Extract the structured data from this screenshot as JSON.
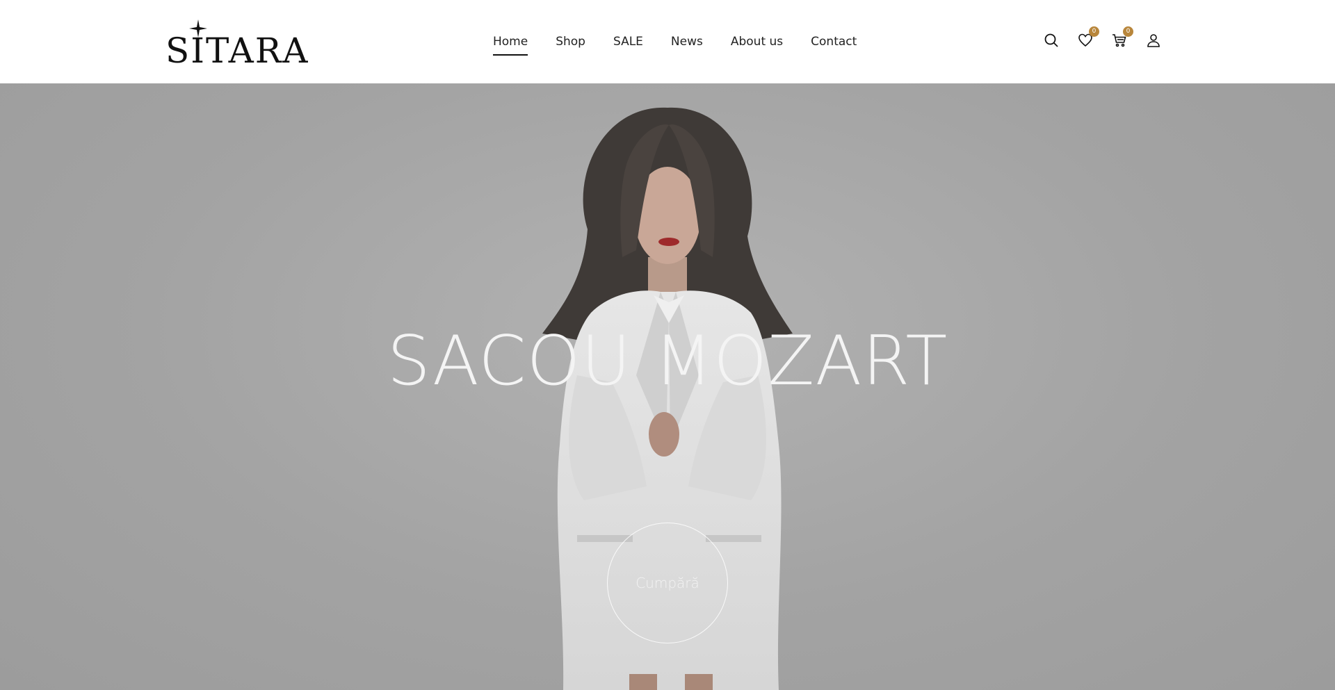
{
  "brand": {
    "name": "SITARA"
  },
  "nav": {
    "items": [
      {
        "label": "Home",
        "active": true
      },
      {
        "label": "Shop",
        "active": false
      },
      {
        "label": "SALE",
        "active": false
      },
      {
        "label": "News",
        "active": false
      },
      {
        "label": "About us",
        "active": false
      },
      {
        "label": "Contact",
        "active": false
      }
    ]
  },
  "header_icons": {
    "search": "search-icon",
    "wishlist": "heart-icon",
    "wishlist_count": "0",
    "cart": "cart-icon",
    "cart_count": "0",
    "account": "user-icon",
    "badge_color": "#b8863b"
  },
  "hero": {
    "title": "SACOU MOZART",
    "cta_label": "Cumpără"
  }
}
